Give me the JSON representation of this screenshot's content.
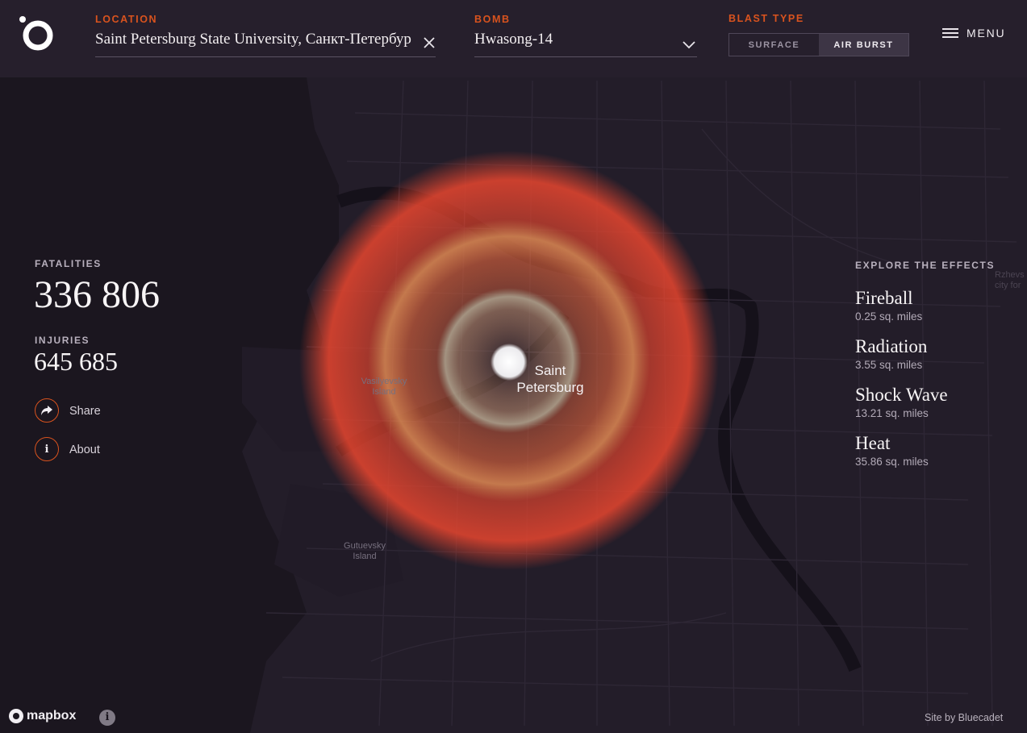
{
  "header": {
    "location_label": "LOCATION",
    "location_value": "Saint Petersburg State University, Санкт-Петербург",
    "bomb_label": "BOMB",
    "bomb_value": "Hwasong-14",
    "blast_type_label": "BLAST TYPE",
    "blast_options": [
      "SURFACE",
      "AIR BURST"
    ],
    "blast_selected": "AIR BURST",
    "menu_label": "MENU"
  },
  "stats": {
    "fatalities_label": "FATALITIES",
    "fatalities_value": "336 806",
    "injuries_label": "INJURIES",
    "injuries_value": "645 685",
    "share_label": "Share",
    "about_label": "About",
    "about_icon_glyph": "i"
  },
  "effects": {
    "heading": "EXPLORE THE EFFECTS",
    "items": [
      {
        "name": "Fireball",
        "area": "0.25 sq. miles"
      },
      {
        "name": "Radiation",
        "area": "3.55 sq. miles"
      },
      {
        "name": "Shock Wave",
        "area": "13.21 sq. miles"
      },
      {
        "name": "Heat",
        "area": "35.86 sq. miles"
      }
    ]
  },
  "map": {
    "city_label": "Saint Petersburg",
    "vasilyevsky_label": "Vasilyevsky Island",
    "gutuevsky_label": "Gutuevsky Island",
    "rzhev_label": "Rzhevs city for",
    "colors": {
      "heat": "#e0432e",
      "shockwave": "#c87a4a",
      "radiation": "#9d9a85",
      "fireball": "#f2f0f2",
      "accent": "#d9531e"
    }
  },
  "footer": {
    "mapbox_label": "mapbox",
    "info_glyph": "i",
    "credit": "Site by Bluecadet"
  }
}
